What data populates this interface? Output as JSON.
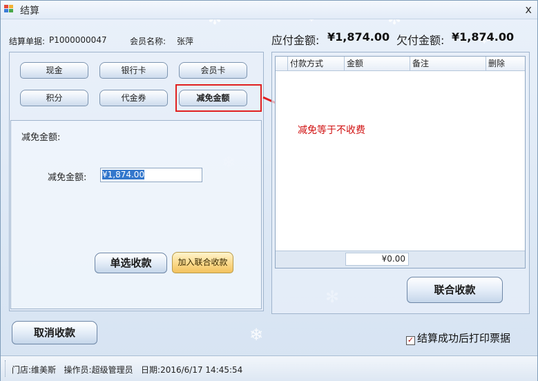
{
  "window": {
    "title": "结算",
    "close_glyph": "x"
  },
  "header": {
    "bill_label": "结算单据:",
    "bill_no": "P1000000047",
    "member_label": "会员名称:",
    "member_name": "张萍",
    "due_label": "应付金额:",
    "due_value": "¥1,874.00",
    "owed_label": "欠付金额:",
    "owed_value": "¥1,874.00"
  },
  "payment_methods": [
    {
      "label": "现金"
    },
    {
      "label": "银行卡"
    },
    {
      "label": "会员卡"
    },
    {
      "label": "积分"
    },
    {
      "label": "代金券"
    },
    {
      "label": "减免金额"
    }
  ],
  "discount": {
    "section_title": "减免金额:",
    "field_label": "减免金额:",
    "field_value": "¥1,874.00"
  },
  "buttons": {
    "single_pay": "单选收款",
    "add_combined": "加入联合收款",
    "combined_pay": "联合收款",
    "cancel_pay": "取消收款"
  },
  "grid": {
    "columns": [
      "付款方式",
      "金额",
      "备注",
      "删除"
    ],
    "rows": [],
    "total": "¥0.00"
  },
  "annotation": "减免等于不收费",
  "print_option": {
    "label": "结算成功后打印票据",
    "checked": true,
    "check_glyph": "✓"
  },
  "status": {
    "store_label": "门店:",
    "store": "维美斯",
    "operator_label": "操作员:",
    "operator": "超级管理员",
    "date_label": "日期:",
    "date": "2016/6/17 14:45:54"
  }
}
